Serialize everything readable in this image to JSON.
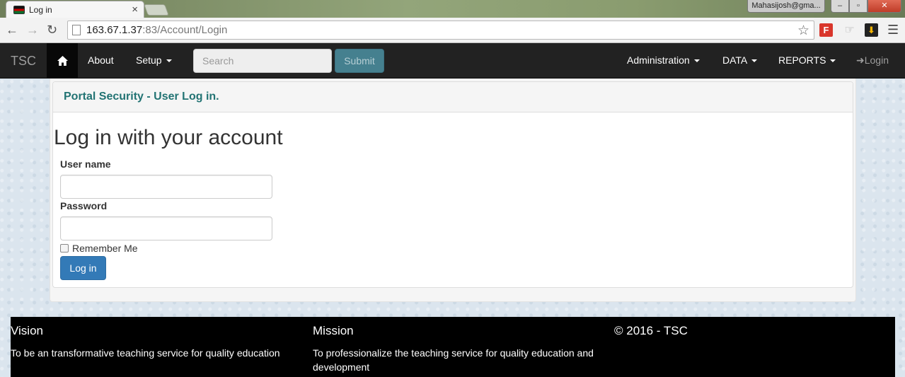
{
  "browser": {
    "tab_title": "Log in",
    "tab_close": "×",
    "user": "Mahasijosh@gma...",
    "window_buttons": [
      "–",
      "▫",
      "✕"
    ],
    "url_host": "163.67.1.37",
    "url_rest": ":83/Account/Login",
    "icons": [
      "back-icon",
      "forward-icon",
      "reload-icon",
      "page-icon",
      "star-icon",
      "menu-icon"
    ],
    "extension_f_label": "F"
  },
  "navbar": {
    "brand": "TSC",
    "about": "About",
    "setup": "Setup",
    "search_placeholder": "Search",
    "submit": "Submit",
    "administration": "Administration",
    "data": "DATA",
    "reports": "REPORTS",
    "login": "Login"
  },
  "panel": {
    "heading": "Portal Security - User Log in."
  },
  "form": {
    "title": "Log in with your account",
    "username_label": "User name",
    "username_value": "",
    "password_label": "Password",
    "password_value": "",
    "remember_label": "Remember Me",
    "remember_checked": false,
    "login_button": "Log in"
  },
  "footer": {
    "vision_title": "Vision",
    "vision_text": "To be an transformative teaching service for quality education",
    "mission_title": "Mission",
    "mission_text": "To professionalize the teaching service for quality education and development",
    "copyright": "© 2016 - TSC"
  },
  "colors": {
    "navbar": "#222222",
    "panel_heading_text": "#227373",
    "primary_button": "#337ab7",
    "submit_button": "#45808f"
  }
}
